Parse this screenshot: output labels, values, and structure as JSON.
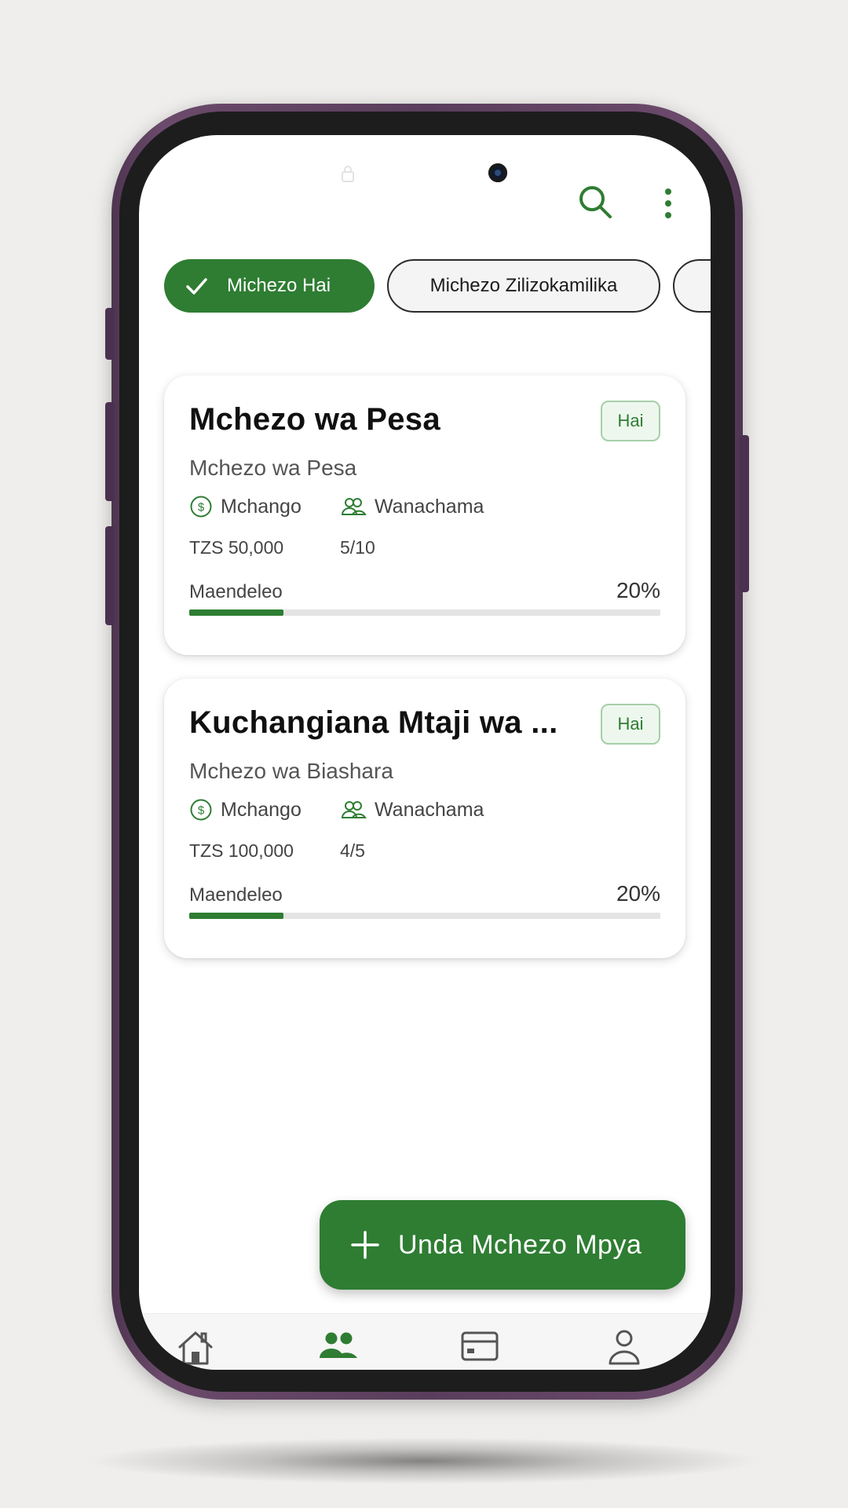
{
  "colors": {
    "accent": "#2e7d32",
    "accent_light": "#eef7ee",
    "background": "#efeeec",
    "phone_frame": "#5a3d5c"
  },
  "header": {
    "search_icon": "search-icon",
    "more_icon": "more-vert-icon"
  },
  "filters": {
    "chips": [
      {
        "label": "Michezo Hai",
        "selected": true
      },
      {
        "label": "Michezo Zilizokamilika",
        "selected": false
      }
    ]
  },
  "games": [
    {
      "title": "Mchezo wa Pesa",
      "subtitle": "Mchezo wa Pesa",
      "status": "Hai",
      "contribution_label": "Mchango",
      "contribution_value": "TZS 50,000",
      "members_label": "Wanachama",
      "members_value": "5/10",
      "progress_label": "Maendeleo",
      "progress_text": "20%",
      "progress_fraction": 0.2
    },
    {
      "title": "Kuchangiana Mtaji wa ...",
      "subtitle": "Mchezo wa Biashara",
      "status": "Hai",
      "contribution_label": "Mchango",
      "contribution_value": "TZS 100,000",
      "members_label": "Wanachama",
      "members_value": "4/5",
      "progress_label": "Maendeleo",
      "progress_text": "20%",
      "progress_fraction": 0.2
    }
  ],
  "fab": {
    "label": "Unda Mchezo Mpya",
    "icon": "plus-icon"
  },
  "bottom_nav": {
    "items": [
      {
        "icon": "home-icon",
        "active": false
      },
      {
        "icon": "groups-icon",
        "active": true
      },
      {
        "icon": "wallet-icon",
        "active": false
      },
      {
        "icon": "profile-icon",
        "active": false
      }
    ]
  }
}
